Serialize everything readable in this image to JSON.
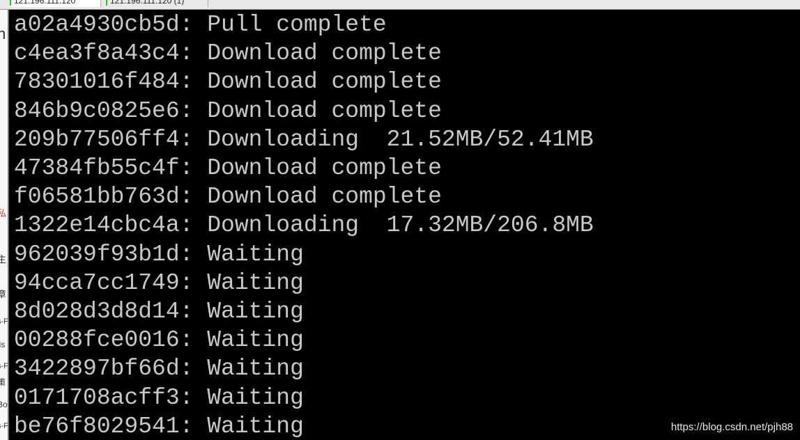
{
  "tabs": [
    {
      "label": "121.196.111.120",
      "active": true
    },
    {
      "label": "121.196.111.120 (1)",
      "active": false
    }
  ],
  "left_fragments": [
    "n",
    "私",
    "主",
    "章",
    "s-F",
    "lis",
    "s-F",
    "策",
    "Bo",
    "s-F"
  ],
  "terminal": {
    "text_color": "#c8c8c8",
    "background": "#000000",
    "lines": [
      "a02a4930cb5d: Pull complete",
      "c4ea3f8a43c4: Download complete",
      "78301016f484: Download complete",
      "846b9c0825e6: Download complete",
      "209b77506ff4: Downloading  21.52MB/52.41MB",
      "47384fb55c4f: Download complete",
      "f06581bb763d: Download complete",
      "1322e14cbc4a: Downloading  17.32MB/206.8MB",
      "962039f93b1d: Waiting",
      "94cca7cc1749: Waiting",
      "8d028d3d8d14: Waiting",
      "00288fce0016: Waiting",
      "3422897bf66d: Waiting",
      "0171708acff3: Waiting",
      "be76f8029541: Waiting"
    ]
  },
  "watermark": "https://blog.csdn.net/pjh88"
}
